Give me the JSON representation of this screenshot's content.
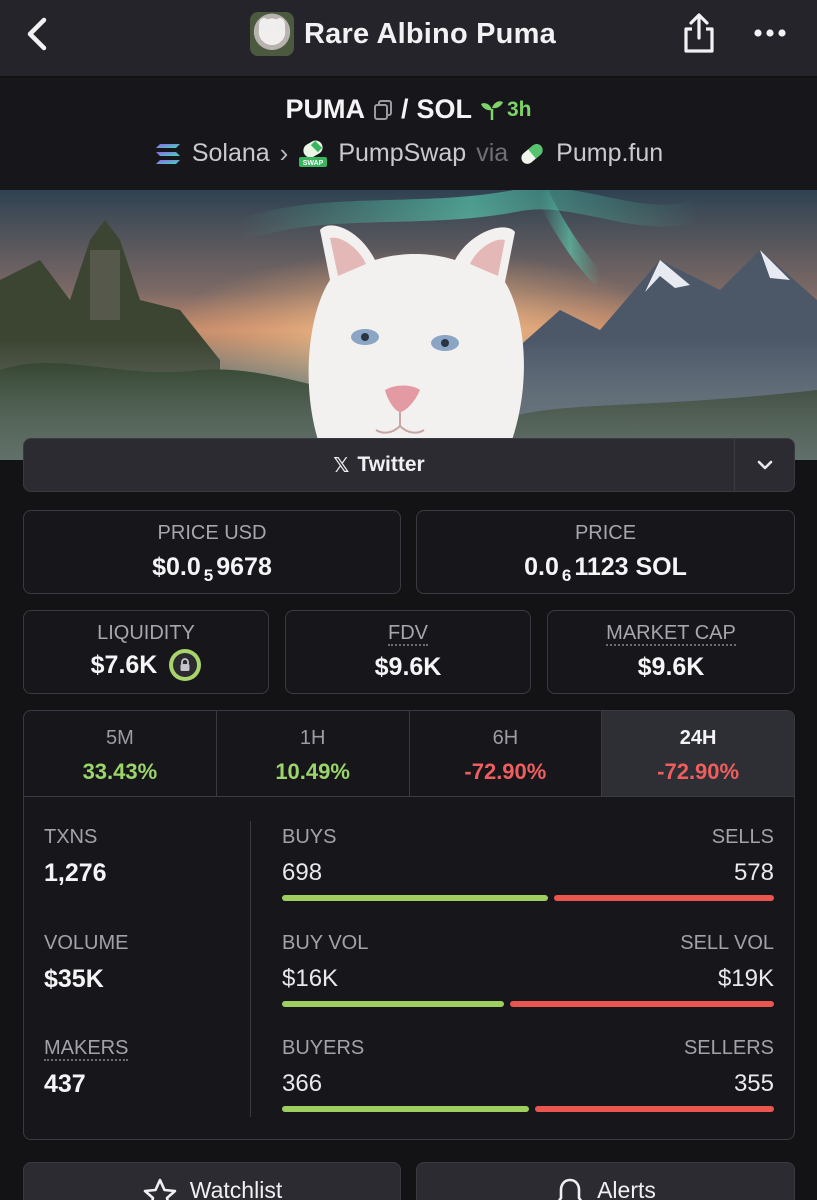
{
  "header": {
    "title": "Rare Albino Puma",
    "back_icon": "chevron-left-icon",
    "share_icon": "share-icon",
    "more_icon": "more-dots-icon"
  },
  "pair": {
    "base": "PUMA",
    "separator": "/",
    "quote": "SOL",
    "age": "3h",
    "chain": "Solana",
    "dex": "PumpSwap",
    "via": "via",
    "launchpad": "Pump.fun",
    "dex_badge": "SWAP"
  },
  "social": {
    "twitter_label": "Twitter",
    "x_glyph": "𝕏"
  },
  "stats": {
    "price_usd": {
      "label": "PRICE USD",
      "prefix": "$0.0",
      "zeros": "5",
      "digits": "9678"
    },
    "price_sol": {
      "label": "PRICE",
      "prefix": "0.0",
      "zeros": "6",
      "digits": "1123 SOL"
    },
    "liquidity": {
      "label": "LIQUIDITY",
      "value": "$7.6K"
    },
    "fdv": {
      "label": "FDV",
      "value": "$9.6K"
    },
    "market_cap": {
      "label": "MARKET CAP",
      "value": "$9.6K"
    }
  },
  "periods": [
    {
      "label": "5M",
      "change": "33.43%",
      "trend": "up"
    },
    {
      "label": "1H",
      "change": "10.49%",
      "trend": "up"
    },
    {
      "label": "6H",
      "change": "-72.90%",
      "trend": "down"
    },
    {
      "label": "24H",
      "change": "-72.90%",
      "trend": "down",
      "active": true
    }
  ],
  "activity": {
    "txns": {
      "label": "TXNS",
      "value": "1,276"
    },
    "volume": {
      "label": "VOLUME",
      "value": "$35K"
    },
    "makers": {
      "label": "MAKERS",
      "value": "437"
    },
    "buys": {
      "left_label": "BUYS",
      "right_label": "SELLS",
      "left": "698",
      "right": "578",
      "buy_fraction": 0.547
    },
    "vol": {
      "left_label": "BUY VOL",
      "right_label": "SELL VOL",
      "left": "$16K",
      "right": "$19K",
      "buy_fraction": 0.457
    },
    "buyers": {
      "left_label": "BUYERS",
      "right_label": "SELLERS",
      "left": "366",
      "right": "355",
      "buy_fraction": 0.508
    }
  },
  "actions": {
    "watchlist": "Watchlist",
    "alerts": "Alerts"
  },
  "colors": {
    "positive": "#9bd46a",
    "negative": "#ef5e5e",
    "buy_bar": "#9dce5f",
    "sell_bar": "#e8564f"
  }
}
